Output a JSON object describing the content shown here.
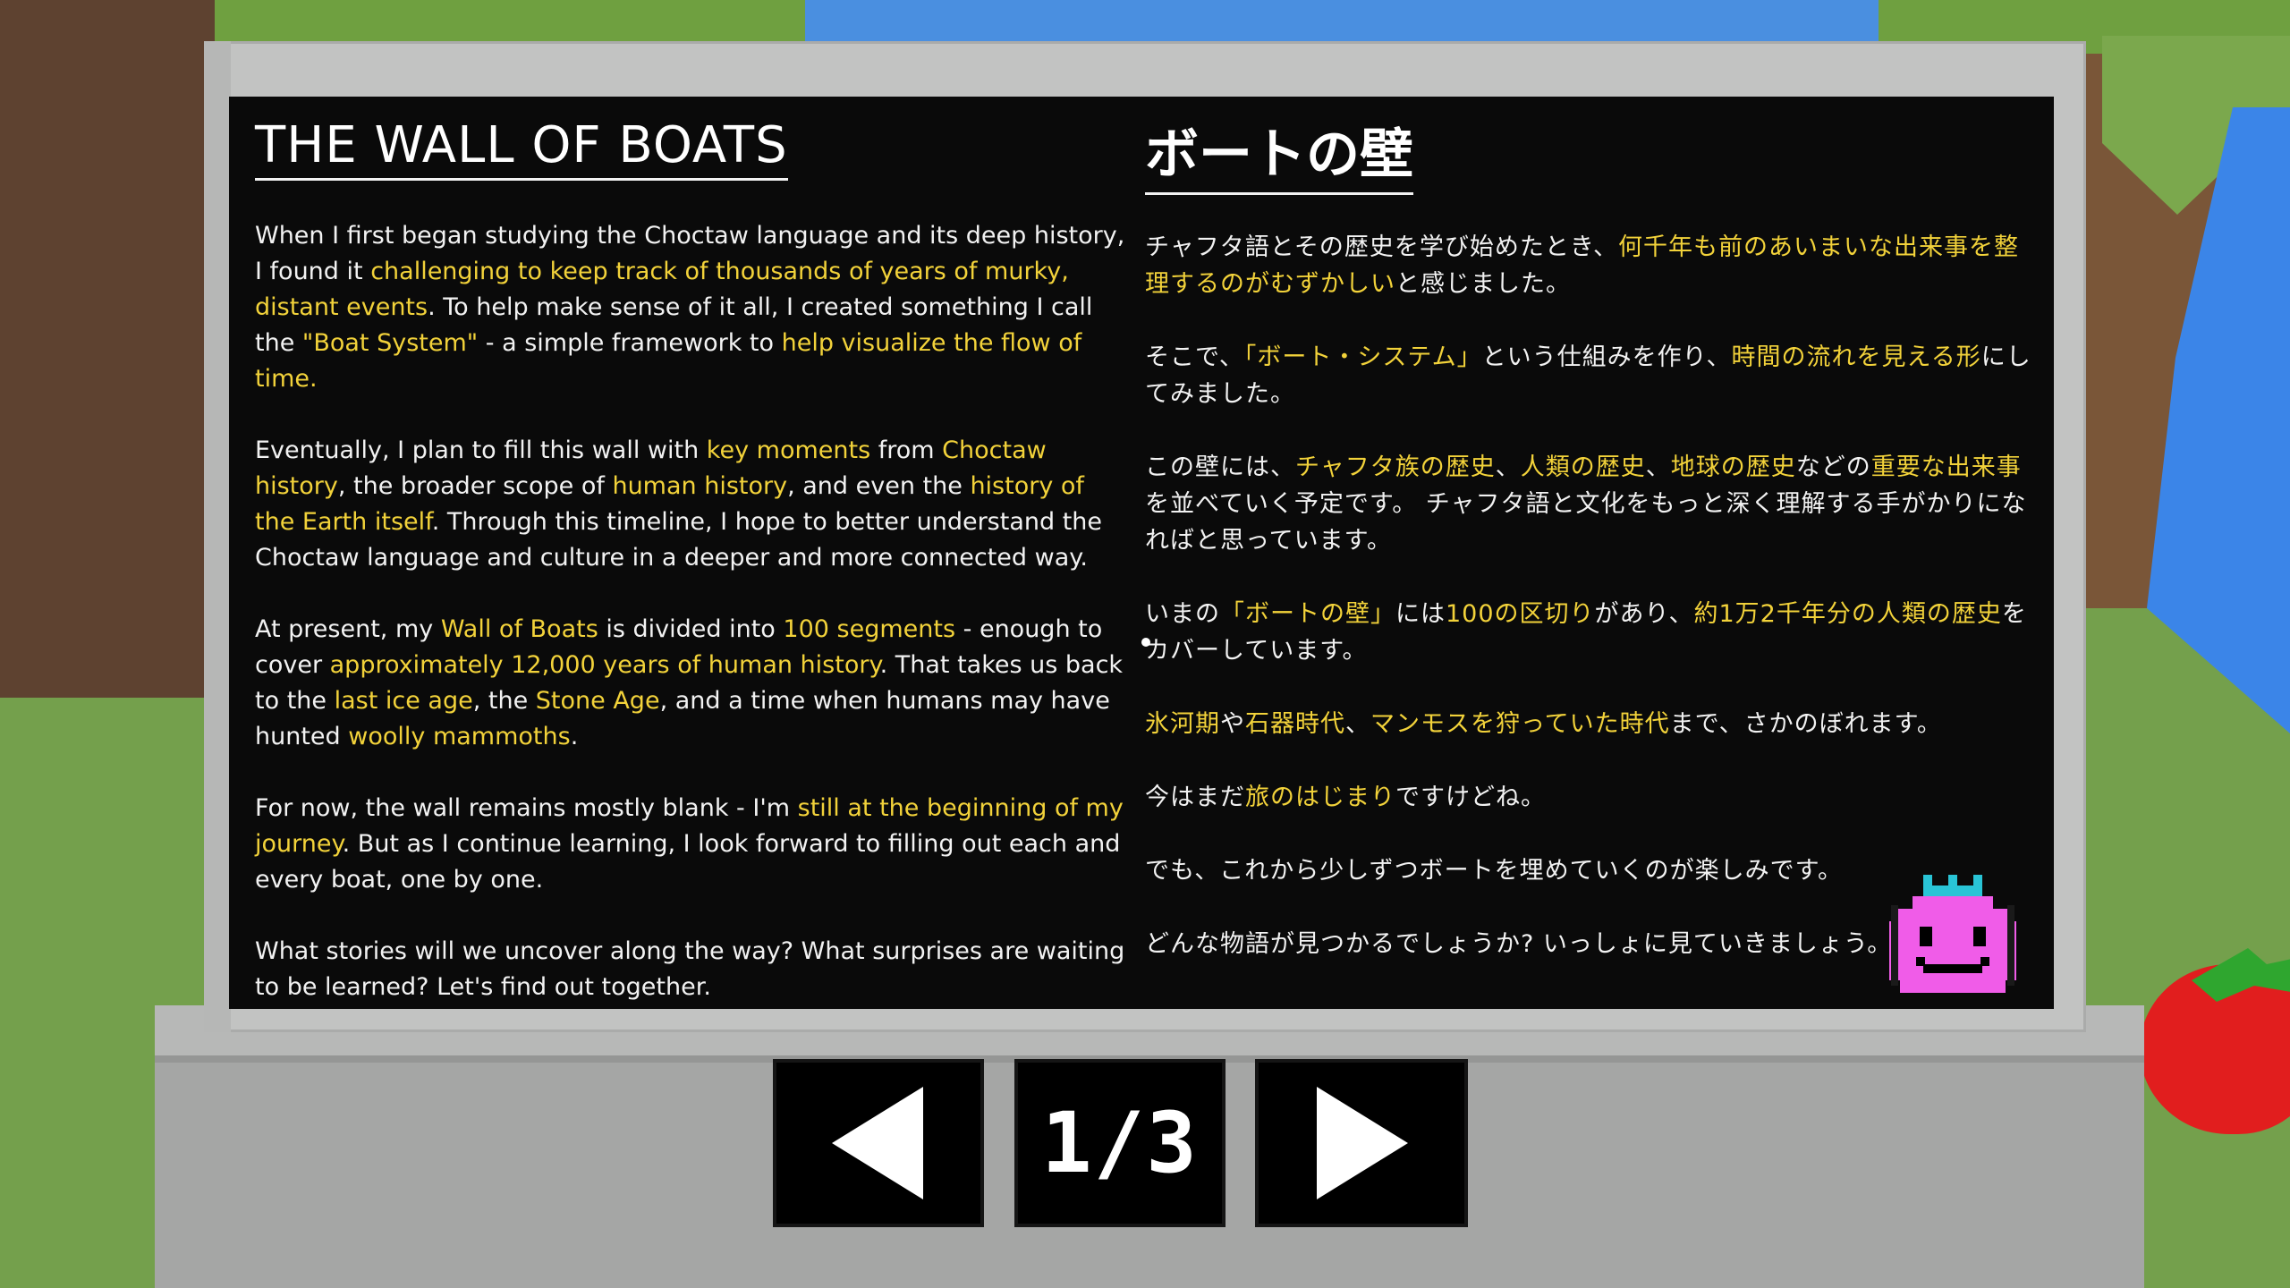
{
  "panel": {
    "english": {
      "title": "THE WALL OF BOATS",
      "paragraphs": [
        [
          {
            "t": "When I first began studying the Choctaw language and its deep history, I found it ",
            "h": false
          },
          {
            "t": "challenging to keep track of thousands of years of murky, distant events",
            "h": true
          },
          {
            "t": ". To help make sense of it all, I created something I call the ",
            "h": false
          },
          {
            "t": "\"Boat System\"",
            "h": true
          },
          {
            "t": " - a simple framework to ",
            "h": false
          },
          {
            "t": "help visualize the flow of time.",
            "h": true
          }
        ],
        [
          {
            "t": "Eventually, I plan to fill this wall with ",
            "h": false
          },
          {
            "t": "key moments",
            "h": true
          },
          {
            "t": " from ",
            "h": false
          },
          {
            "t": "Choctaw history",
            "h": true
          },
          {
            "t": ", the broader scope of ",
            "h": false
          },
          {
            "t": "human history",
            "h": true
          },
          {
            "t": ", and even the ",
            "h": false
          },
          {
            "t": "history of the Earth itself",
            "h": true
          },
          {
            "t": ". Through this timeline, I hope to better understand the Choctaw language and culture in a deeper and more connected way.",
            "h": false
          }
        ],
        [
          {
            "t": "At present, my ",
            "h": false
          },
          {
            "t": "Wall of Boats",
            "h": true
          },
          {
            "t": " is divided into ",
            "h": false
          },
          {
            "t": "100 segments",
            "h": true
          },
          {
            "t": " - enough to cover ",
            "h": false
          },
          {
            "t": "approximately 12,000 years of human history",
            "h": true
          },
          {
            "t": ". That takes us back to the ",
            "h": false
          },
          {
            "t": "last ice age",
            "h": true
          },
          {
            "t": ", the ",
            "h": false
          },
          {
            "t": "Stone Age",
            "h": true
          },
          {
            "t": ", and a time when humans may have hunted ",
            "h": false
          },
          {
            "t": "woolly mammoths",
            "h": true
          },
          {
            "t": ".",
            "h": false
          }
        ],
        [
          {
            "t": "For now, the wall remains mostly blank - I'm ",
            "h": false
          },
          {
            "t": "still at the beginning of my journey",
            "h": true
          },
          {
            "t": ". But as I continue learning, I look forward to filling out each and every boat, one by one.",
            "h": false
          }
        ],
        [
          {
            "t": "What stories will we uncover along the way? What surprises are waiting to be learned? Let's find out together.",
            "h": false
          }
        ]
      ]
    },
    "japanese": {
      "title": "ボートの壁",
      "paragraphs": [
        [
          {
            "t": "チャフタ語とその歴史を学び始めたとき、",
            "h": false
          },
          {
            "t": "何千年も前のあいまいな出来事を整理するのがむずかしい",
            "h": true
          },
          {
            "t": "と感じました。",
            "h": false
          }
        ],
        [
          {
            "t": "そこで、",
            "h": false
          },
          {
            "t": "「ボート・システム」",
            "h": true
          },
          {
            "t": "という仕組みを作り、",
            "h": false
          },
          {
            "t": "時間の流れを見える形",
            "h": true
          },
          {
            "t": "にしてみました。",
            "h": false
          }
        ],
        [
          {
            "t": "この壁には、",
            "h": false
          },
          {
            "t": "チャフタ族の歴史",
            "h": true
          },
          {
            "t": "、",
            "h": false
          },
          {
            "t": "人類の歴史",
            "h": true
          },
          {
            "t": "、",
            "h": false
          },
          {
            "t": "地球の歴史",
            "h": true
          },
          {
            "t": "などの",
            "h": false
          },
          {
            "t": "重要な出来事",
            "h": true
          },
          {
            "t": "を並べていく予定です。 チャフタ語と文化をもっと深く理解する手がかりになればと思っています。",
            "h": false
          }
        ],
        [
          {
            "t": "いまの",
            "h": false
          },
          {
            "t": "「ボートの壁」",
            "h": true
          },
          {
            "t": "には",
            "h": false
          },
          {
            "t": "100の区切り",
            "h": true
          },
          {
            "t": "があり、",
            "h": false
          },
          {
            "t": "約1万2千年分の人類の歴史",
            "h": true
          },
          {
            "t": "をカバーしています。",
            "h": false
          }
        ],
        [
          {
            "t": "氷河期",
            "h": true
          },
          {
            "t": "や",
            "h": false
          },
          {
            "t": "石器時代",
            "h": true
          },
          {
            "t": "、",
            "h": false
          },
          {
            "t": "マンモスを狩っていた時代",
            "h": true
          },
          {
            "t": "まで、さかのぼれます。",
            "h": false
          }
        ],
        [
          {
            "t": "今はまだ",
            "h": false
          },
          {
            "t": "旅のはじまり",
            "h": true
          },
          {
            "t": "ですけどね。",
            "h": false
          }
        ],
        [
          {
            "t": "でも、これから少しずつボートを埋めていくのが楽しみです。",
            "h": false
          }
        ],
        [
          {
            "t": "どんな物語が見つかるでしょうか? いっしょに見ていきましょう。",
            "h": false
          }
        ]
      ]
    }
  },
  "navigation": {
    "page_indicator": "1/3",
    "prev_icon": "left-triangle-icon",
    "next_icon": "right-triangle-icon"
  },
  "colors": {
    "highlight": "#f2d23a",
    "body_text": "#f2f2f2",
    "screen_bg": "#0a0a0a",
    "mascot_pink": "#f05ce8",
    "mascot_crown": "#29c4d6"
  },
  "mascot": {
    "icon": "pink-blob-mascot-icon"
  }
}
